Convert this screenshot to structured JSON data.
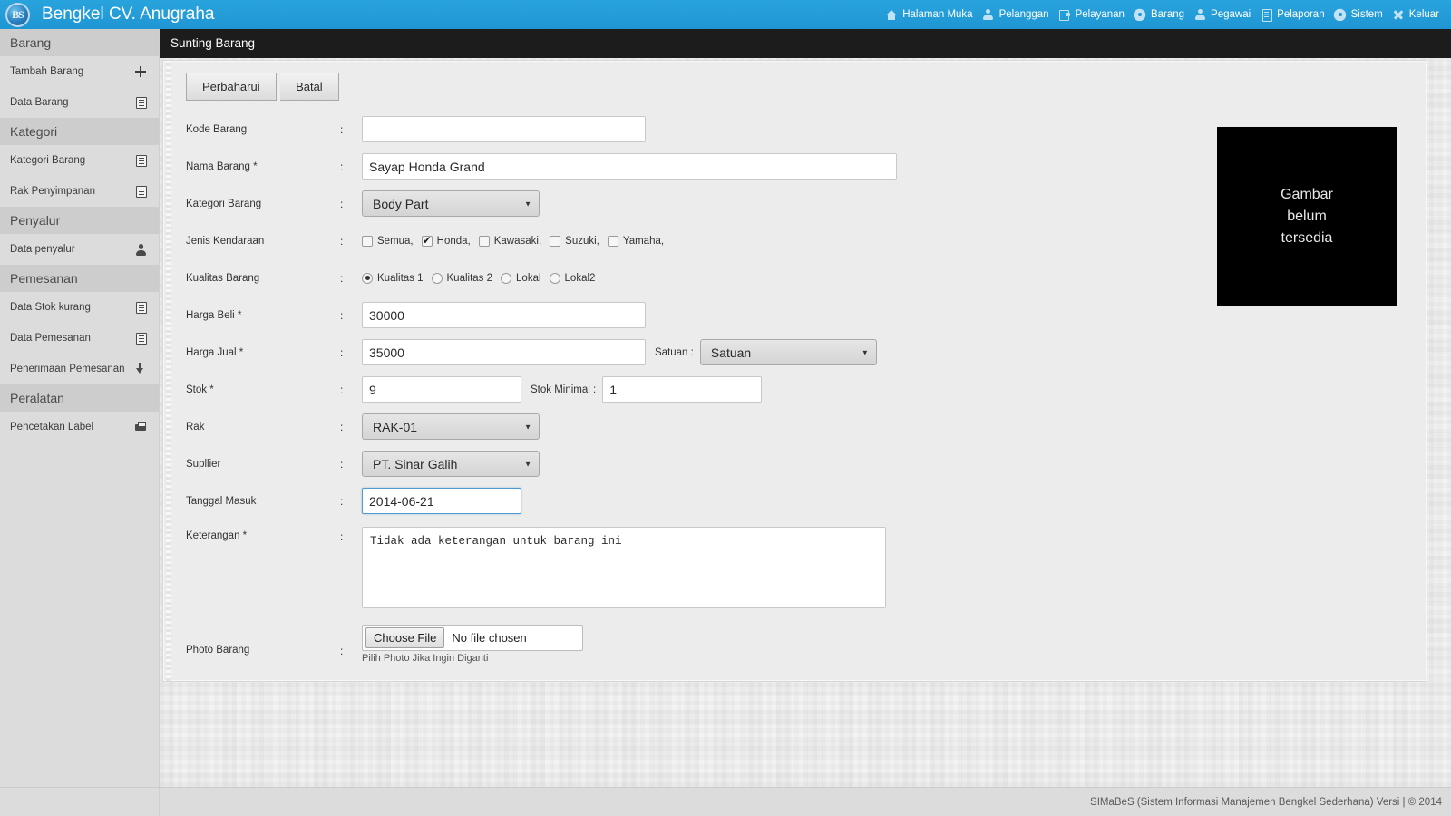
{
  "header": {
    "brand": "Bengkel CV. Anugraha",
    "logo_text": "BS",
    "nav": [
      {
        "label": "Halaman Muka",
        "icon": "home-icon"
      },
      {
        "label": "Pelanggan",
        "icon": "person-icon"
      },
      {
        "label": "Pelayanan",
        "icon": "service-icon"
      },
      {
        "label": "Barang",
        "icon": "gear-icon"
      },
      {
        "label": "Pegawai",
        "icon": "person-icon"
      },
      {
        "label": "Pelaporan",
        "icon": "report-icon"
      },
      {
        "label": "Sistem",
        "icon": "gear-icon"
      },
      {
        "label": "Keluar",
        "icon": "close-icon"
      }
    ]
  },
  "sidebar": {
    "groups": [
      {
        "title": "Barang",
        "items": [
          {
            "label": "Tambah Barang",
            "icon": "plus-icon"
          },
          {
            "label": "Data Barang",
            "icon": "list-icon"
          }
        ]
      },
      {
        "title": "Kategori",
        "items": [
          {
            "label": "Kategori Barang",
            "icon": "list-icon"
          },
          {
            "label": "Rak Penyimpanan",
            "icon": "list-icon"
          }
        ]
      },
      {
        "title": "Penyalur",
        "items": [
          {
            "label": "Data penyalur",
            "icon": "person-icon"
          }
        ]
      },
      {
        "title": "Pemesanan",
        "items": [
          {
            "label": "Data Stok kurang",
            "icon": "list-icon"
          },
          {
            "label": "Data Pemesanan",
            "icon": "list-icon"
          },
          {
            "label": "Penerimaan Pemesanan",
            "icon": "download-icon"
          }
        ]
      },
      {
        "title": "Peralatan",
        "items": [
          {
            "label": "Pencetakan Label",
            "icon": "printer-icon"
          }
        ]
      }
    ]
  },
  "page": {
    "title": "Sunting Barang",
    "buttons": {
      "submit": "Perbaharui",
      "cancel": "Batal"
    }
  },
  "form": {
    "colon": ":",
    "kode_barang": {
      "label": "Kode Barang",
      "value": "",
      "placeholder": ""
    },
    "nama_barang": {
      "label": "Nama Barang *",
      "value": "Sayap Honda Grand"
    },
    "kategori_barang": {
      "label": "Kategori Barang",
      "value": "Body Part",
      "options": [
        "Body Part"
      ]
    },
    "jenis_kendaraan": {
      "label": "Jenis Kendaraan",
      "options": [
        {
          "label": "Semua,",
          "checked": false
        },
        {
          "label": "Honda,",
          "checked": true
        },
        {
          "label": "Kawasaki,",
          "checked": false
        },
        {
          "label": "Suzuki,",
          "checked": false
        },
        {
          "label": "Yamaha,",
          "checked": false
        }
      ]
    },
    "kualitas_barang": {
      "label": "Kualitas Barang",
      "options": [
        {
          "label": "Kualitas 1",
          "checked": true
        },
        {
          "label": "Kualitas 2",
          "checked": false
        },
        {
          "label": "Lokal",
          "checked": false
        },
        {
          "label": "Lokal2",
          "checked": false
        }
      ]
    },
    "harga_beli": {
      "label": "Harga Beli *",
      "value": "30000"
    },
    "harga_jual": {
      "label": "Harga Jual *",
      "value": "35000"
    },
    "satuan": {
      "label": "Satuan :",
      "value": "Satuan",
      "options": [
        "Satuan"
      ]
    },
    "stok": {
      "label": "Stok *",
      "value": "9"
    },
    "stok_minimal": {
      "label": "Stok Minimal :",
      "value": "1"
    },
    "rak": {
      "label": "Rak",
      "value": "RAK-01",
      "options": [
        "RAK-01"
      ]
    },
    "supllier": {
      "label": "Supllier",
      "value": "PT. Sinar Galih",
      "options": [
        "PT. Sinar Galih"
      ]
    },
    "tanggal_masuk": {
      "label": "Tanggal Masuk",
      "value": "2014-06-21",
      "focused": true
    },
    "keterangan": {
      "label": "Keterangan *",
      "value": "Tidak ada keterangan untuk barang ini"
    },
    "photo_barang": {
      "label": "Photo Barang",
      "choose_label": "Choose File",
      "file_status": "No file chosen",
      "hint": "Pilih Photo Jika Ingin Diganti"
    }
  },
  "image_preview": {
    "line1": "Gambar",
    "line2": "belum",
    "line3": "tersedia"
  },
  "footer": {
    "text": "SIMaBeS (Sistem Informasi Manajemen Bengkel Sederhana) Versi | © 2014"
  },
  "colors": {
    "accent": "#1e96d4",
    "pagehead_bg": "#1c1c1c",
    "sidebar_bg": "#dcdcdc",
    "panel_bg": "#ececec",
    "focus_border": "#4f9bd2"
  }
}
